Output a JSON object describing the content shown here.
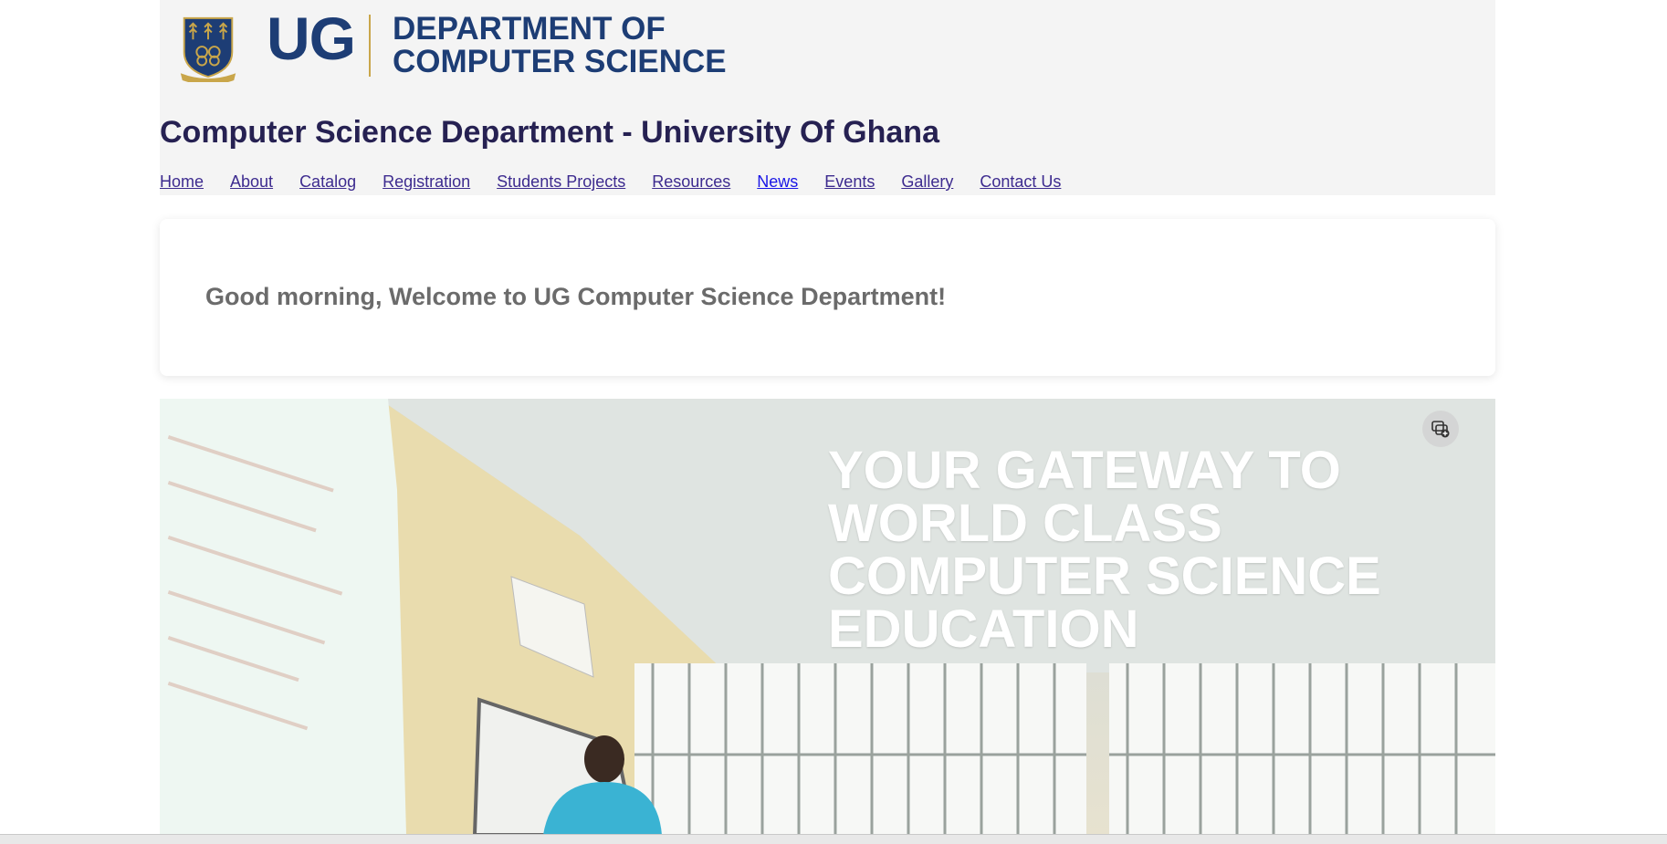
{
  "header": {
    "logo_mark": "UG",
    "dept_name_line1": "DEPARTMENT OF",
    "dept_name_line2": "COMPUTER SCIENCE",
    "site_title": "Computer Science Department - University Of Ghana"
  },
  "nav": {
    "items": [
      {
        "label": "Home"
      },
      {
        "label": "About"
      },
      {
        "label": "Catalog"
      },
      {
        "label": "Registration"
      },
      {
        "label": "Students Projects"
      },
      {
        "label": "Resources"
      },
      {
        "label": "News",
        "current": true
      },
      {
        "label": "Events"
      },
      {
        "label": "Gallery"
      },
      {
        "label": "Contact Us"
      }
    ]
  },
  "greeting": {
    "text": "Good morning, Welcome to UG Computer Science Department!"
  },
  "hero": {
    "headline": "YOUR GATEWAY TO WORLD CLASS COMPUTER SCIENCE EDUCATION",
    "media_icon": "picture-in-picture-icon"
  },
  "colors": {
    "brand_blue": "#1d3d75",
    "title": "#262152",
    "link": "#3d2b8f",
    "gold": "#c9a64a"
  }
}
